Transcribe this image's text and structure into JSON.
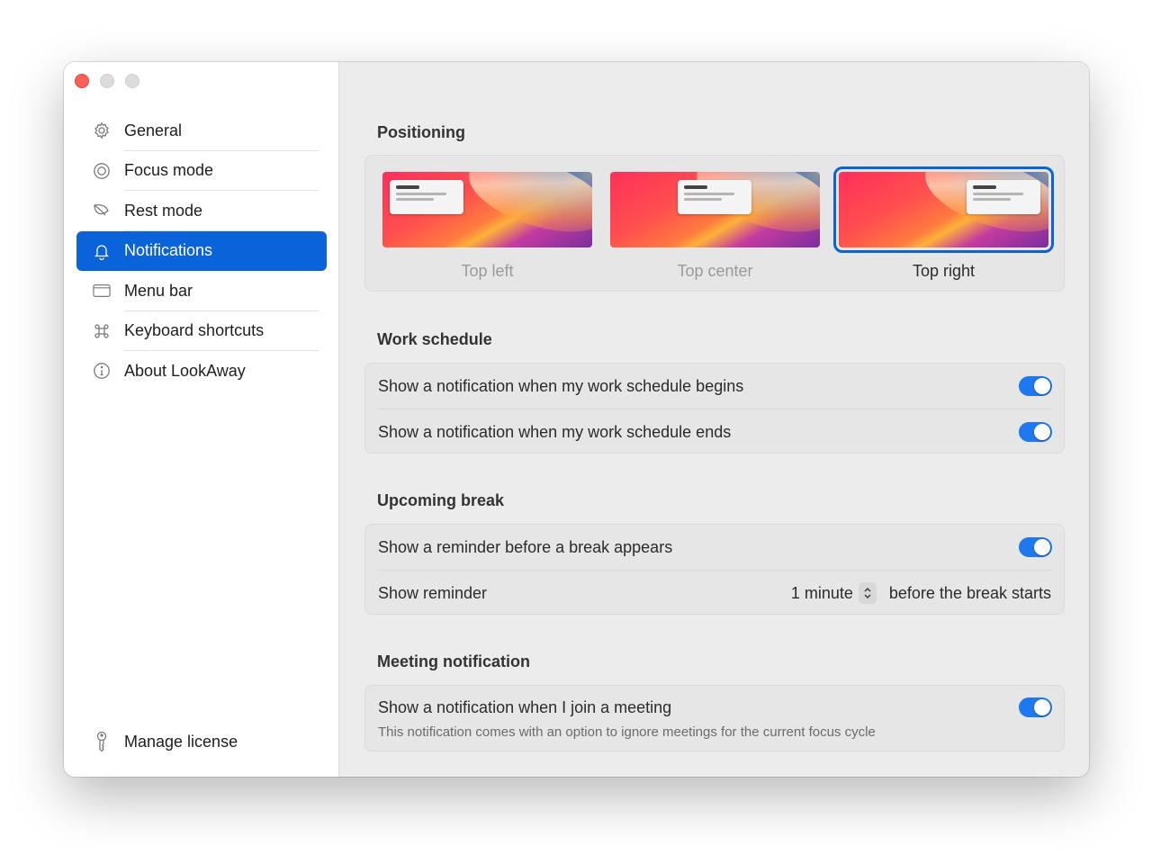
{
  "sidebar": {
    "items": [
      {
        "label": "General",
        "icon": "gear-icon"
      },
      {
        "label": "Focus mode",
        "icon": "target-icon"
      },
      {
        "label": "Rest mode",
        "icon": "leaf-icon"
      },
      {
        "label": "Notifications",
        "icon": "bell-icon",
        "active": true
      },
      {
        "label": "Menu bar",
        "icon": "menu-bar-icon"
      },
      {
        "label": "Keyboard shortcuts",
        "icon": "command-icon"
      },
      {
        "label": "About LookAway",
        "icon": "info-icon"
      }
    ],
    "license_label": "Manage license"
  },
  "positioning": {
    "title": "Positioning",
    "options": [
      {
        "label": "Top left",
        "selected": false
      },
      {
        "label": "Top center",
        "selected": false
      },
      {
        "label": "Top right",
        "selected": true
      }
    ]
  },
  "work_schedule": {
    "title": "Work schedule",
    "rows": [
      {
        "label": "Show a notification when my work schedule begins",
        "enabled": true
      },
      {
        "label": "Show a notification when my work schedule ends",
        "enabled": true
      }
    ]
  },
  "upcoming_break": {
    "title": "Upcoming break",
    "reminder_toggle_label": "Show a reminder before a break appears",
    "reminder_toggle_enabled": true,
    "reminder_label": "Show reminder",
    "reminder_value": "1 minute",
    "reminder_suffix": "before the break starts"
  },
  "meeting": {
    "title": "Meeting notification",
    "label": "Show a notification when I join a meeting",
    "description": "This notification comes with an option to ignore meetings for the current focus cycle",
    "enabled": true
  },
  "colors": {
    "accent": "#0a63d9",
    "toggle_on": "#1e78ef",
    "close_button": "#fe5f57"
  }
}
